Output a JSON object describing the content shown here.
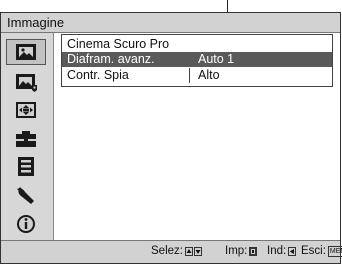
{
  "window": {
    "title": "Immagine"
  },
  "sidebar": {
    "tabs": [
      {
        "icon": "picture-icon",
        "active": true
      },
      {
        "icon": "picture-advanced-icon",
        "active": false
      },
      {
        "icon": "screen-icon",
        "active": false
      },
      {
        "icon": "setup-icon",
        "active": false
      },
      {
        "icon": "function-icon",
        "active": false
      },
      {
        "icon": "installation-icon",
        "active": false
      },
      {
        "icon": "information-icon",
        "active": false
      }
    ]
  },
  "menu": {
    "header": "Cinema Scuro Pro",
    "rows": [
      {
        "label": "Diafram. avanz.",
        "value": "Auto 1",
        "selected": true
      },
      {
        "label": "Contr. Spia",
        "value": "Alto",
        "selected": false
      }
    ]
  },
  "footer": {
    "select_label": "Selez:",
    "enter_label": "Imp:",
    "back_label": "Ind:",
    "exit_label": "Esci:",
    "menu_key": "MENU"
  }
}
